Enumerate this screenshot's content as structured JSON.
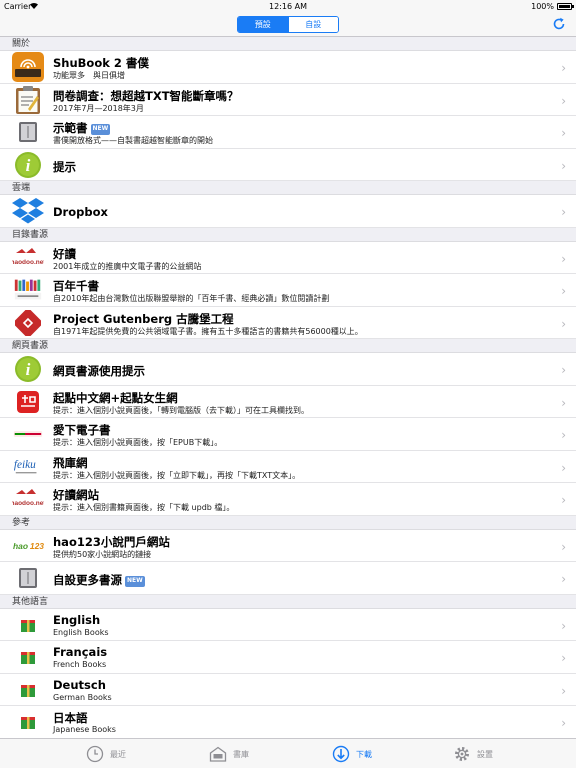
{
  "status_bar": {
    "carrier": "Carrier",
    "time": "12:16 AM",
    "battery": "100%"
  },
  "nav": {
    "segments": [
      {
        "label": "預設",
        "active": true
      },
      {
        "label": "自設",
        "active": false
      }
    ]
  },
  "sections": [
    {
      "header": "關於",
      "rows": [
        {
          "id": "shubook",
          "icon": "shubook-app-icon",
          "title": "ShuBook 2 書僕",
          "subtitle": "功能眾多　與日俱增"
        },
        {
          "id": "survey",
          "icon": "clipboard-icon",
          "title": "問卷調查：想超越TXT智能斷章嗎？",
          "subtitle": "2017年7月—2018年3月"
        },
        {
          "id": "sample-book",
          "icon": "book-icon",
          "title": "示範書",
          "badge": "NEW",
          "subtitle": "書僕開放格式——自製書超越智能斷章的開始"
        },
        {
          "id": "tips",
          "icon": "info-icon",
          "title": "提示",
          "subtitle": ""
        }
      ]
    },
    {
      "header": "雲端",
      "rows": [
        {
          "id": "dropbox",
          "icon": "dropbox-icon",
          "title": "Dropbox",
          "subtitle": ""
        }
      ]
    },
    {
      "header": "目錄書源",
      "rows": [
        {
          "id": "haodoo",
          "icon": "haodoo-logo-icon",
          "title": "好讀",
          "subtitle": "2001年成立的推廣中文電子書的公益網站"
        },
        {
          "id": "100books",
          "icon": "hundred-books-logo-icon",
          "title": "百年千書",
          "subtitle": "自2010年起由台灣數位出版聯盟舉辦的「百年千書、經典必讀」數位閱讀計劃"
        },
        {
          "id": "gutenberg",
          "icon": "gutenberg-logo-icon",
          "title": "Project Gutenberg 古騰堡工程",
          "subtitle": "自1971年起提供免費的公共領域電子書。擁有五十多種語言的書籍共有56000種以上。"
        }
      ]
    },
    {
      "header": "網頁書源",
      "rows": [
        {
          "id": "web-tips",
          "icon": "info-icon",
          "title": "網頁書源使用提示",
          "subtitle": ""
        },
        {
          "id": "qidian",
          "icon": "qidian-logo-icon",
          "title": "起點中文網+起點女生網",
          "subtitle": "提示：進入個別小說頁面後，「轉到電腦版（去下載）」可在工具欄找到。"
        },
        {
          "id": "ixdzs",
          "icon": "ixdzs-logo-icon",
          "title": "愛下電子書",
          "subtitle": "提示：進入個別小說頁面後，按「EPUB下載」。"
        },
        {
          "id": "feiku",
          "icon": "feiku-logo-icon",
          "title": "飛庫網",
          "subtitle": "提示：進入個別小說頁面後，按「立即下載」，再按「下載TXT文本」。"
        },
        {
          "id": "haodoo-site",
          "icon": "haodoo-logo-icon",
          "title": "好讀網站",
          "subtitle": "提示：進入個別書籍頁面後，按「下載 updb 檔」。"
        }
      ]
    },
    {
      "header": "參考",
      "rows": [
        {
          "id": "hao123",
          "icon": "hao123-logo-icon",
          "title": "hao123小說門戶網站",
          "subtitle": "提供約50家小說網站的鏈接"
        },
        {
          "id": "custom-sources",
          "icon": "book-icon",
          "title": "自設更多書源",
          "badge": "NEW",
          "subtitle": ""
        }
      ]
    },
    {
      "header": "其他語言",
      "rows": [
        {
          "id": "english",
          "icon": "gift-books-icon",
          "title": "English",
          "subtitle": "English Books"
        },
        {
          "id": "francais",
          "icon": "gift-books-icon",
          "title": "Français",
          "subtitle": "French Books"
        },
        {
          "id": "deutsch",
          "icon": "gift-books-icon",
          "title": "Deutsch",
          "subtitle": "German Books"
        },
        {
          "id": "japanese",
          "icon": "gift-books-icon",
          "title": "日本語",
          "subtitle": "Japanese Books"
        }
      ]
    }
  ],
  "tabs": [
    {
      "id": "recent",
      "icon": "clock-icon",
      "label": "最近",
      "active": false
    },
    {
      "id": "library",
      "icon": "library-icon",
      "label": "書庫",
      "active": false
    },
    {
      "id": "download",
      "icon": "download-icon",
      "label": "下載",
      "active": true
    },
    {
      "id": "settings",
      "icon": "gear-icon",
      "label": "設置",
      "active": false
    }
  ],
  "colors": {
    "accent": "#1a7cf5",
    "section_bg": "#efeff4",
    "bar_bg": "#f7f7f7"
  }
}
